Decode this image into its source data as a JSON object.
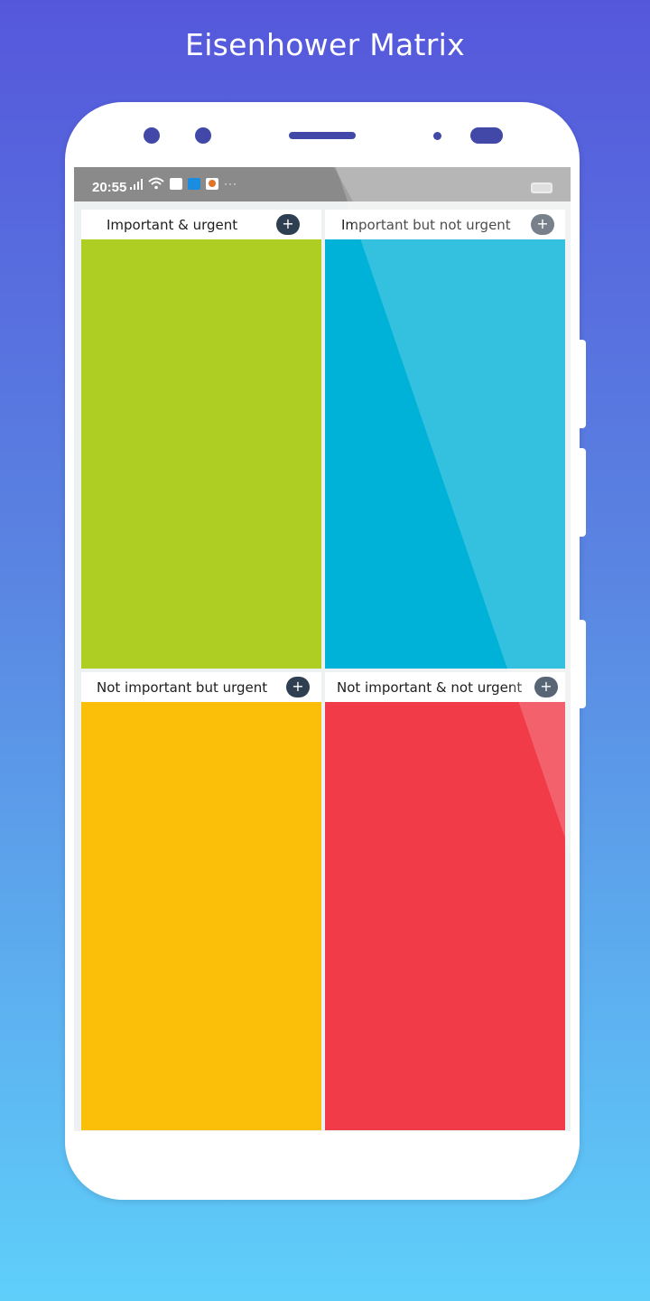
{
  "promo": {
    "title": "Eisenhower Matrix"
  },
  "status_bar": {
    "time": "20:55",
    "more_indicator": "···",
    "icons": [
      "signal-icon",
      "wifi-icon",
      "notification-icon",
      "notification-icon",
      "chrome-icon",
      "battery-icon"
    ]
  },
  "quadrants": [
    {
      "label": "Important & urgent",
      "add_label": "+",
      "color": "#aece23"
    },
    {
      "label": "Important but not urgent",
      "add_label": "+",
      "color": "#00b2d7"
    },
    {
      "label": "Not important but urgent",
      "add_label": "+",
      "color": "#fbbf0a"
    },
    {
      "label": "Not important & not urgent",
      "add_label": "+",
      "color": "#f13b48"
    }
  ]
}
